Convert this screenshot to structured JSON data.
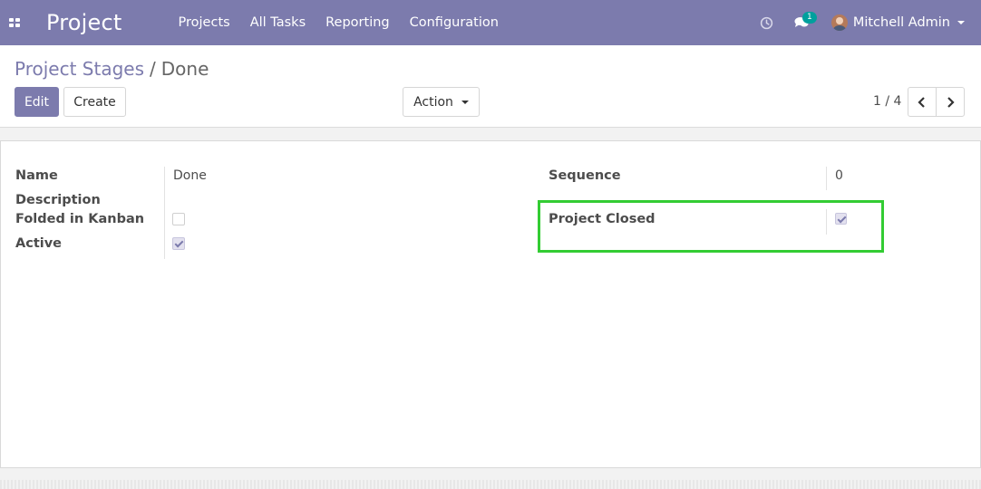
{
  "navbar": {
    "app_title": "Project",
    "menu": [
      "Projects",
      "All Tasks",
      "Reporting",
      "Configuration"
    ],
    "messages_badge": "1",
    "user_name": "Mitchell Admin",
    "icons": {
      "apps": "apps-grid-icon",
      "activity": "clock-icon",
      "messages": "chat-icon"
    }
  },
  "breadcrumb": {
    "parent": "Project Stages",
    "separator": "/",
    "current": "Done"
  },
  "toolbar": {
    "edit_label": "Edit",
    "create_label": "Create",
    "action_label": "Action"
  },
  "pager": {
    "value": "1 / 4"
  },
  "form": {
    "name_label": "Name",
    "name_value": "Done",
    "description_label": "Description",
    "folded_label": "Folded in Kanban",
    "folded_checked": false,
    "active_label": "Active",
    "active_checked": true,
    "sequence_label": "Sequence",
    "sequence_value": "0",
    "project_closed_label": "Project Closed",
    "project_closed_checked": true
  },
  "colors": {
    "brand": "#7c7bad",
    "highlight": "#33cc33",
    "badge": "#00a09d"
  }
}
